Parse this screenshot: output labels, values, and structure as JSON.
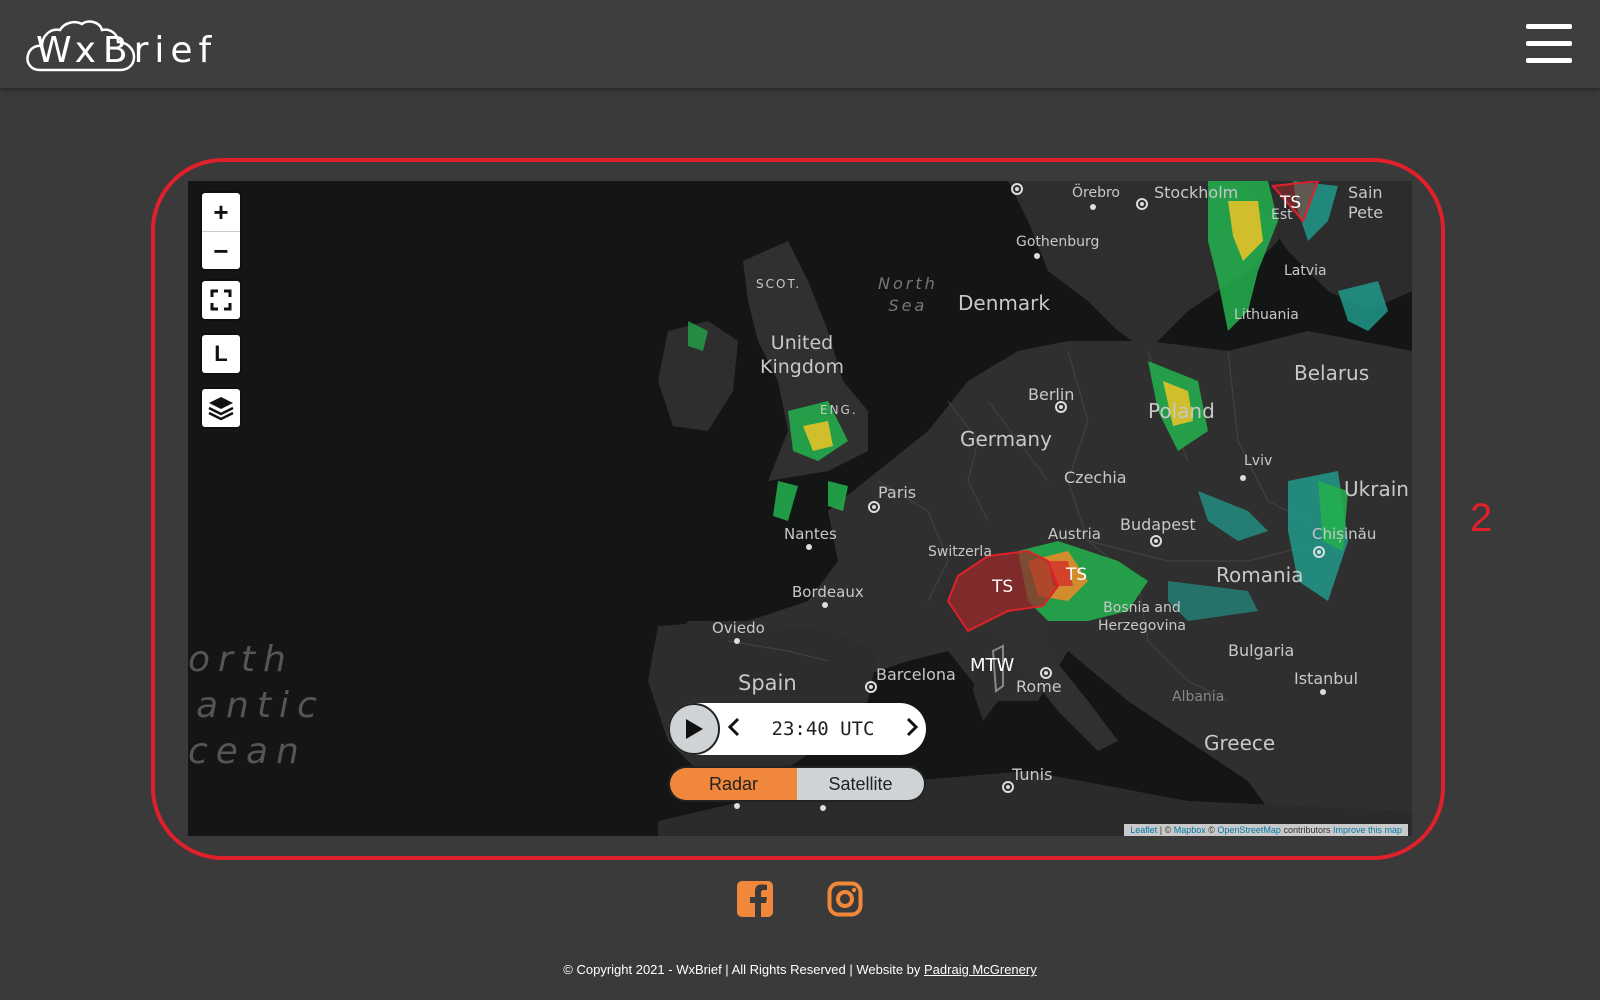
{
  "header": {
    "logo_prefix": "Wx",
    "logo_suffix": "Brief",
    "menu_icon": "hamburger-menu-icon"
  },
  "annotation": {
    "number": "2",
    "color": "#e0202a"
  },
  "map": {
    "controls": {
      "zoom_in": "+",
      "zoom_out": "−",
      "fullscreen_icon": "fullscreen-icon",
      "layer_toggle": "L",
      "layers_icon": "layers-icon"
    },
    "places": {
      "orebro": "Örebro",
      "stockholm": "Stockholm",
      "gothenburg": "Gothenburg",
      "denmark": "Denmark",
      "north_sea": "North\nSea",
      "scot": "SCOT.",
      "uk": "United\nKingdom",
      "eng": "ENG.",
      "berlin": "Berlin",
      "germany": "Germany",
      "czechia": "Czechia",
      "poland": "Poland",
      "lithuania": "Lithuania",
      "latvia": "Latvia",
      "belarus": "Belarus",
      "lviv": "Lviv",
      "ukraine": "Ukrain",
      "paris": "Paris",
      "nantes": "Nantes",
      "bordeaux": "Bordeaux",
      "switzerland": "Switzerla",
      "austria": "Austria",
      "budapest": "Budapest",
      "romania": "Romania",
      "chisinau": "Chișinău",
      "oviedo": "Oviedo",
      "spain": "Spain",
      "barcelona": "Barcelona",
      "rome": "Rome",
      "bosnia": "Bosnia and\nHerzegovina",
      "bulgaria": "Bulgaria",
      "istanbul": "Istanbul",
      "albania": "Albania",
      "greece": "Greece",
      "tunis": "Tunis",
      "saint_pete": "Sain\nPete",
      "estonia": "Est"
    },
    "ocean": [
      "orth",
      "antic",
      "cean"
    ],
    "warnings": [
      "TS",
      "TS",
      "TS",
      "MTW"
    ],
    "time": "23:40 UTC",
    "modes": {
      "radar": "Radar",
      "satellite": "Satellite",
      "active": "Radar"
    },
    "attribution": {
      "leaflet": "Leaflet",
      "sep1": " | © ",
      "mapbox": "Mapbox",
      "sep2": " © ",
      "osm": "OpenStreetMap",
      "contrib": " contributors ",
      "improve": "Improve this map"
    }
  },
  "social": {
    "facebook_icon": "facebook-icon",
    "instagram_icon": "instagram-icon",
    "color": "#f0873a"
  },
  "footer": {
    "copyright": "Copyright 2021 - WxBrief | All Rights Reserved | Website by ",
    "author": "Padraig McGrenery"
  }
}
